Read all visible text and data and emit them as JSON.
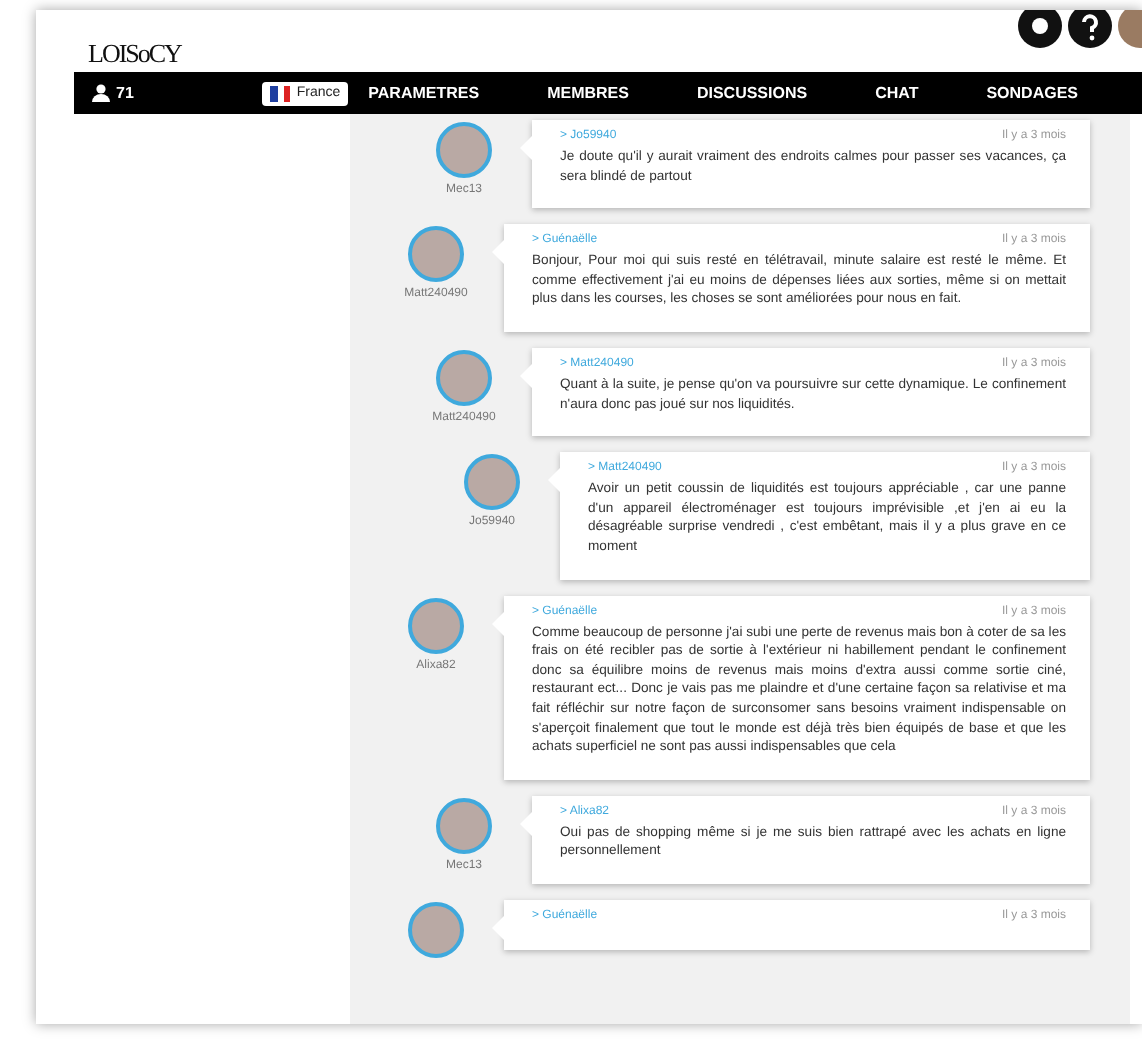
{
  "header": {
    "logo": "LOISoCY"
  },
  "nav": {
    "online_count": "71",
    "language": "France",
    "tabs": [
      {
        "label": "PARAMETRES",
        "selected": false
      },
      {
        "label": "MEMBRES",
        "selected": false
      },
      {
        "label": "DISCUSSIONS",
        "selected": false
      },
      {
        "label": "CHAT",
        "selected": false
      },
      {
        "label": "SONDAGES",
        "selected": false
      }
    ]
  },
  "comments": [
    {
      "kind": "reply",
      "author": "Mec13",
      "reply_to": "> Jo59940",
      "time": "Il y a 3 mois",
      "text": "Je doute qu'il y aurait vraiment des endroits calmes pour passer ses vacances, ça sera blindé de partout"
    },
    {
      "kind": "comment",
      "author": "Matt240490",
      "reply_to": "> Guénaëlle",
      "time": "Il y a 3 mois",
      "text": "Bonjour, Pour moi qui suis resté en télétravail, minute salaire est resté le même. Et comme effectivement j'ai eu moins de dépenses liées aux sorties, même si on mettait plus dans les courses, les choses se sont améliorées pour nous en fait.",
      "children": [
        {
          "kind": "comment",
          "author": "Matt240490",
          "reply_to": "> Matt240490",
          "time": "Il y a 3 mois",
          "text": "Quant à la suite, je pense qu'on va poursuivre sur cette dynamique. Le confinement n'aura donc pas joué sur nos liquidités.",
          "children": [
            {
              "kind": "comment",
              "author": "Jo59940",
              "reply_to": "> Matt240490",
              "time": "Il y a 3 mois",
              "text": "Avoir un petit coussin de liquidités est toujours appréciable , car une panne d'un appareil électroménager est toujours imprévisible ,et j'en ai eu la désagréable surprise vendredi , c'est embêtant, mais il y a plus grave en ce moment"
            }
          ]
        }
      ]
    },
    {
      "kind": "comment",
      "author": "Alixa82",
      "reply_to": "> Guénaëlle",
      "time": "Il y a 3 mois",
      "text": "Comme beaucoup de personne j'ai subi une perte de revenus mais bon à coter de sa les frais on été recibler pas de sortie à l'extérieur ni habillement pendant le confinement donc sa équilibre moins de revenus mais moins d'extra aussi comme sortie ciné, restaurant ect... Donc je vais pas me plaindre et d'une certaine façon sa relativise et ma fait réfléchir sur notre façon de surconsomer sans besoins vraiment indispensable on s'aperçoit finalement que tout le monde est déjà très bien équipés de base et que les achats superficiel ne sont pas aussi indispensables que cela",
      "children": [
        {
          "kind": "comment",
          "author": "Mec13",
          "reply_to": "> Alixa82",
          "time": "Il y a 3 mois",
          "text": "Oui pas de shopping même si je me suis bien rattrapé avec les achats en ligne personnellement"
        }
      ]
    },
    {
      "kind": "comment",
      "reply_to": "> Guénaëlle",
      "time": "Il y a 3 mois"
    }
  ]
}
